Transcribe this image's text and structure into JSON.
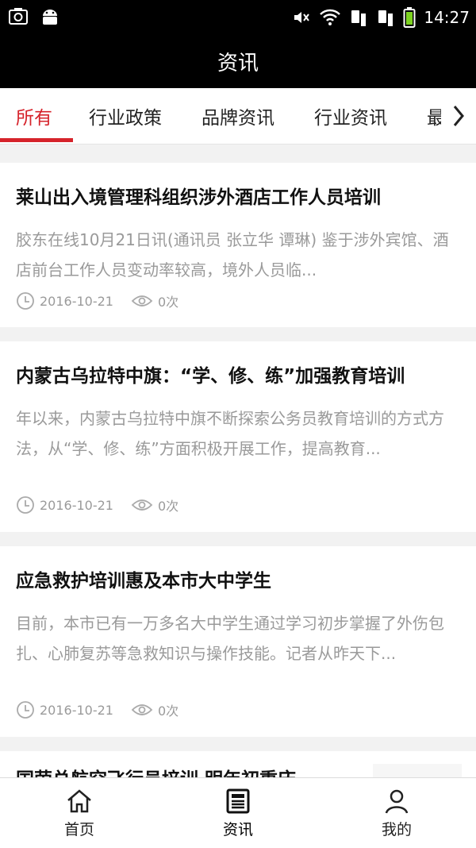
{
  "status_bar": {
    "time": "14:27"
  },
  "header": {
    "title": "资讯"
  },
  "tabs": [
    {
      "label": "所有",
      "active": true
    },
    {
      "label": "行业政策",
      "active": false
    },
    {
      "label": "品牌资讯",
      "active": false
    },
    {
      "label": "行业资讯",
      "active": false
    },
    {
      "label": "最",
      "active": false
    }
  ],
  "articles": [
    {
      "title": "莱山出入境管理科组织涉外酒店工作人员培训",
      "summary": "胶东在线10月21日讯(通讯员 张立华 谭琳) 鉴于涉外宾馆、酒店前台工作人员变动率较高，境外人员临...",
      "date": "2016-10-21",
      "views": "0次"
    },
    {
      "title": "内蒙古乌拉特中旗：“学、修、练”加强教育培训",
      "summary": "年以来，内蒙古乌拉特中旗不断探索公务员教育培训的方式方法，从“学、修、练”方面积极开展工作，提高教育...",
      "date": "2016-10-21",
      "views": "0次"
    },
    {
      "title": "应急救护培训惠及本市大中学生",
      "summary": "目前，本市已有一万多名大中学生通过学习初步掌握了外伤包扎、心肺复苏等急救知识与操作技能。记者从昨天下...",
      "date": "2016-10-21",
      "views": "0次"
    }
  ],
  "partial_article": {
    "title": "国荣总航空飞行员培训 明年初重庆"
  },
  "bottom_nav": [
    {
      "label": "首页",
      "icon": "home-icon",
      "active": false
    },
    {
      "label": "资讯",
      "icon": "news-icon",
      "active": true
    },
    {
      "label": "我的",
      "icon": "user-icon",
      "active": false
    }
  ],
  "colors": {
    "accent": "#d6232b",
    "header_bg": "#000000",
    "muted_text": "#9a9a9a"
  }
}
